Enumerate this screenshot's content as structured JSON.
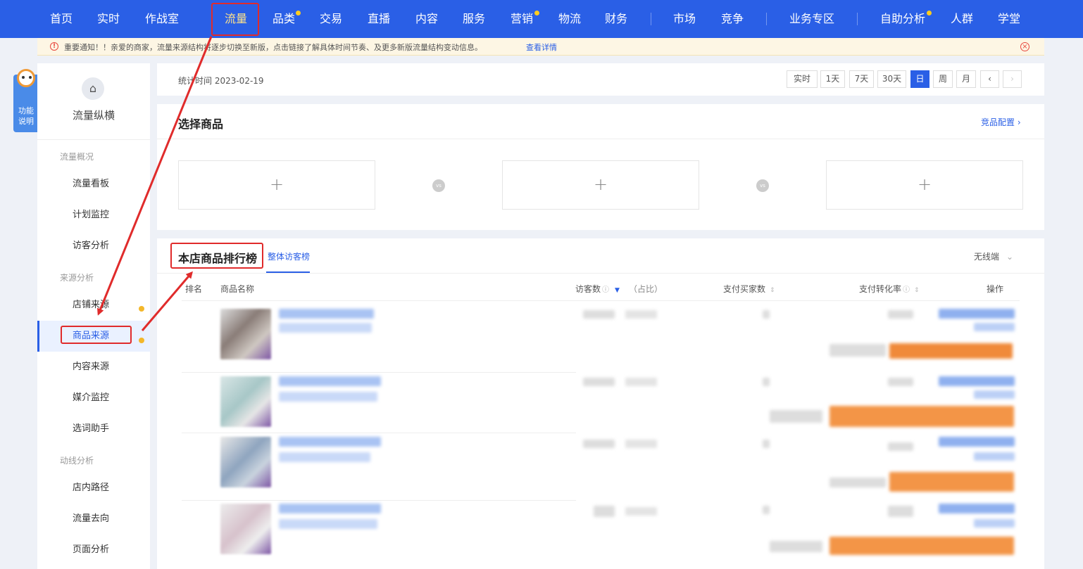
{
  "topnav": {
    "items": [
      {
        "label": "首页"
      },
      {
        "label": "实时"
      },
      {
        "label": "作战室"
      },
      {
        "label": "流量"
      },
      {
        "label": "品类"
      },
      {
        "label": "交易"
      },
      {
        "label": "直播"
      },
      {
        "label": "内容"
      },
      {
        "label": "服务"
      },
      {
        "label": "营销"
      },
      {
        "label": "物流"
      },
      {
        "label": "财务"
      },
      {
        "label": "市场"
      },
      {
        "label": "竞争"
      },
      {
        "label": "业务专区"
      },
      {
        "label": "自助分析"
      },
      {
        "label": "人群"
      },
      {
        "label": "学堂"
      }
    ],
    "active": "流量"
  },
  "notice": {
    "text": "重要通知！！亲爱的商家，流量来源结构将逐步切换至新版，点击链接了解具体时间节奏、及更多新版流量结构变动信息。",
    "link": "查看详情"
  },
  "helper": {
    "label": "功能说明"
  },
  "sidebar": {
    "title": "流量纵横",
    "groups": [
      {
        "label": "流量概况"
      },
      {
        "label": "来源分析"
      },
      {
        "label": "动线分析"
      }
    ],
    "items": [
      {
        "label": "流量看板"
      },
      {
        "label": "计划监控"
      },
      {
        "label": "访客分析"
      },
      {
        "label": "店铺来源"
      },
      {
        "label": "商品来源"
      },
      {
        "label": "内容来源"
      },
      {
        "label": "媒介监控"
      },
      {
        "label": "选词助手"
      },
      {
        "label": "店内路径"
      },
      {
        "label": "流量去向"
      },
      {
        "label": "页面分析"
      }
    ],
    "active": "商品来源"
  },
  "timebar": {
    "stat_time": "统计时间 2023-02-19",
    "buttons": [
      "实时",
      "1天",
      "7天",
      "30天",
      "日",
      "周",
      "月"
    ],
    "active": "日",
    "prev": "‹",
    "next": "›"
  },
  "select_card": {
    "title": "选择商品",
    "config_link": "竞品配置 ›",
    "slot_plus": "+",
    "vs": "vs"
  },
  "ranking": {
    "title": "本店商品排行榜",
    "tab": "整体访客榜",
    "device": "无线端",
    "columns": {
      "rank": "排名",
      "name": "商品名称",
      "visitors": "访客数",
      "share": "（占比）",
      "buyers": "支付买家数",
      "conversion": "支付转化率",
      "action": "操作"
    }
  },
  "colors": {
    "brand": "#2a5fe6",
    "annotation": "#e02b2b",
    "notice_bg": "#fdf6e4"
  }
}
